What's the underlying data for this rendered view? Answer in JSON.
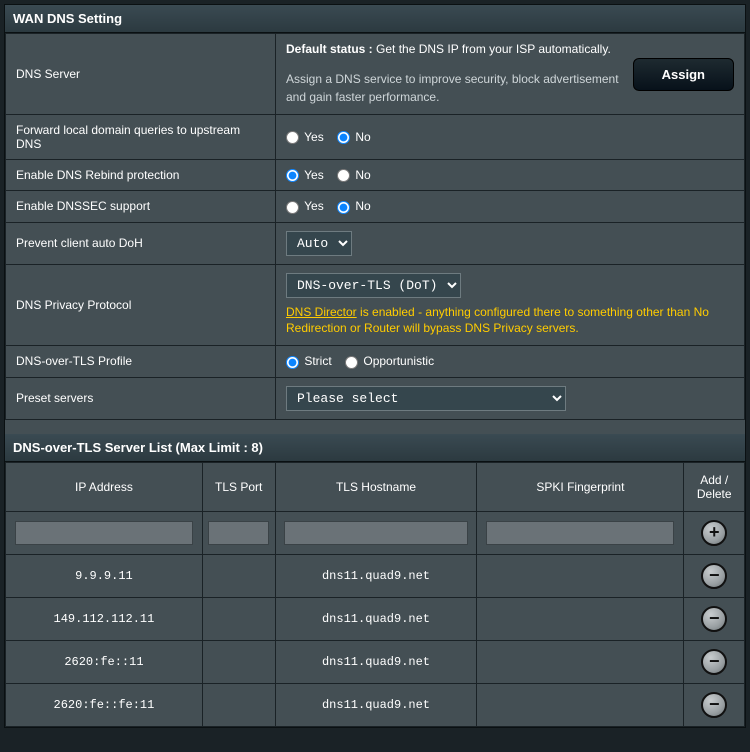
{
  "section1_title": "WAN DNS Setting",
  "dns_server": {
    "label": "DNS Server",
    "default_label": "Default status :",
    "default_text": "Get the DNS IP from your ISP automatically.",
    "desc": "Assign a DNS service to improve security, block advertisement and gain faster performance.",
    "assign_btn": "Assign"
  },
  "forward_local": {
    "label": "Forward local domain queries to upstream DNS",
    "yes": "Yes",
    "no": "No",
    "value": "No"
  },
  "rebind": {
    "label": "Enable DNS Rebind protection",
    "yes": "Yes",
    "no": "No",
    "value": "Yes"
  },
  "dnssec": {
    "label": "Enable DNSSEC support",
    "yes": "Yes",
    "no": "No",
    "value": "No"
  },
  "prevent_doh": {
    "label": "Prevent client auto DoH",
    "value": "Auto"
  },
  "privacy_proto": {
    "label": "DNS Privacy Protocol",
    "value": "DNS-over-TLS (DoT)",
    "warn_link": "DNS Director",
    "warn_rest": " is enabled - anything configured there to something other than No Redirection or Router will bypass DNS Privacy servers."
  },
  "dot_profile": {
    "label": "DNS-over-TLS Profile",
    "strict": "Strict",
    "opp": "Opportunistic",
    "value": "Strict"
  },
  "preset": {
    "label": "Preset servers",
    "value": "Please select"
  },
  "section2_title": "DNS-over-TLS Server List (Max Limit : 8)",
  "cols": {
    "ip": "IP Address",
    "port": "TLS Port",
    "host": "TLS Hostname",
    "spki": "SPKI Fingerprint",
    "act": "Add / Delete"
  },
  "rows": [
    {
      "ip": "9.9.9.11",
      "port": "",
      "host": "dns11.quad9.net",
      "spki": ""
    },
    {
      "ip": "149.112.112.11",
      "port": "",
      "host": "dns11.quad9.net",
      "spki": ""
    },
    {
      "ip": "2620:fe::11",
      "port": "",
      "host": "dns11.quad9.net",
      "spki": ""
    },
    {
      "ip": "2620:fe::fe:11",
      "port": "",
      "host": "dns11.quad9.net",
      "spki": ""
    }
  ]
}
